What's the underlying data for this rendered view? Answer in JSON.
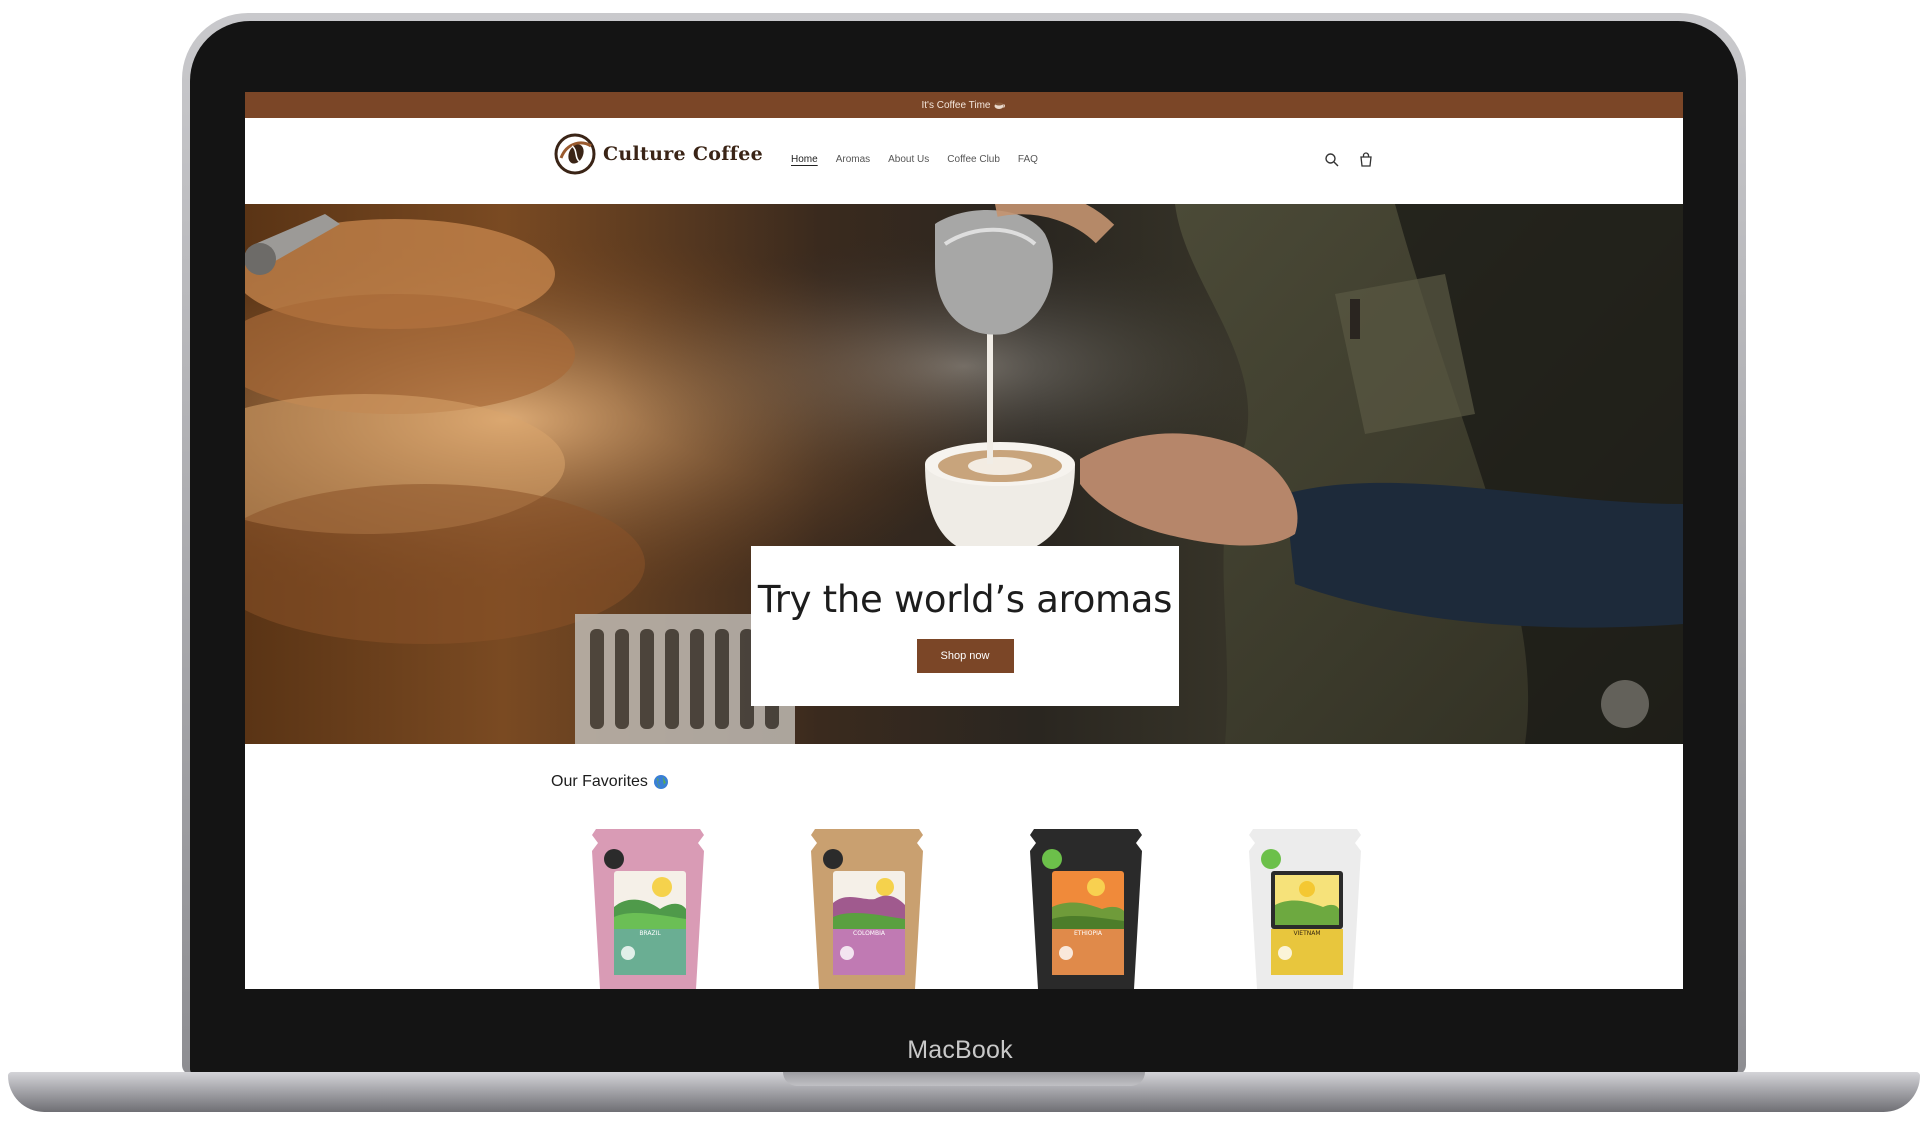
{
  "announcement": {
    "text": "It's Coffee Time",
    "emoji_icon": "coffee-cup-icon"
  },
  "brand": {
    "name": "Culture Coffee"
  },
  "nav": {
    "items": [
      {
        "label": "Home",
        "active": true
      },
      {
        "label": "Aromas",
        "active": false
      },
      {
        "label": "About Us",
        "active": false
      },
      {
        "label": "Coffee Club",
        "active": false
      },
      {
        "label": "FAQ",
        "active": false
      }
    ]
  },
  "header_icons": [
    "search-icon",
    "cart-icon"
  ],
  "hero": {
    "title": "Try the world’s aromas",
    "button_label": "Shop now"
  },
  "favorites": {
    "title": "Our Favorites",
    "products": [
      {
        "label": "BRAZIL",
        "bag_color": "#d99bb5",
        "label_color": "#6aae93"
      },
      {
        "label": "COLOMBIA",
        "bag_color": "#c9a070",
        "label_color": "#c07ab3"
      },
      {
        "label": "ETHIOPIA",
        "bag_color": "#2a2a2a",
        "label_color": "#e08a4a"
      },
      {
        "label": "VIETNAM",
        "bag_color": "#ececec",
        "label_color": "#e8c63d"
      }
    ]
  },
  "device": {
    "label": "MacBook"
  },
  "colors": {
    "accent": "#7b4627",
    "text": "#1d1d1d"
  }
}
